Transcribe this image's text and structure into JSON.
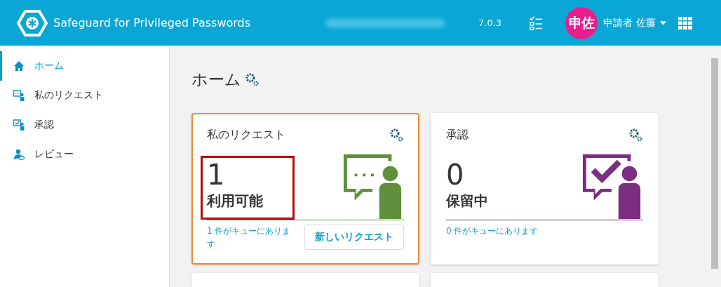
{
  "header": {
    "title": "Safeguard for Privileged Passwords",
    "version": "7.0.3",
    "avatar": "申佐",
    "user": "申請者 佐藤"
  },
  "sidebar": {
    "items": [
      {
        "label": "ホーム",
        "kind": "home",
        "selected": true
      },
      {
        "label": "私のリクエスト",
        "kind": "request",
        "selected": false
      },
      {
        "label": "承認",
        "kind": "approve",
        "selected": false
      },
      {
        "label": "レビュー",
        "kind": "review",
        "selected": false
      }
    ]
  },
  "page": {
    "title": "ホーム"
  },
  "cards": [
    {
      "kind": "request",
      "title": "私のリクエスト",
      "count": "1",
      "status": "利用可能",
      "footer": "1 件がキューにあります",
      "button": "新しいリクエスト",
      "color": "#5f8f3a",
      "selected": true,
      "highlighted": true
    },
    {
      "kind": "approve",
      "title": "承認",
      "count": "0",
      "status": "保留中",
      "footer": "0 件がキューにあります",
      "color": "#7b2d82",
      "selected": false,
      "highlighted": false
    }
  ]
}
